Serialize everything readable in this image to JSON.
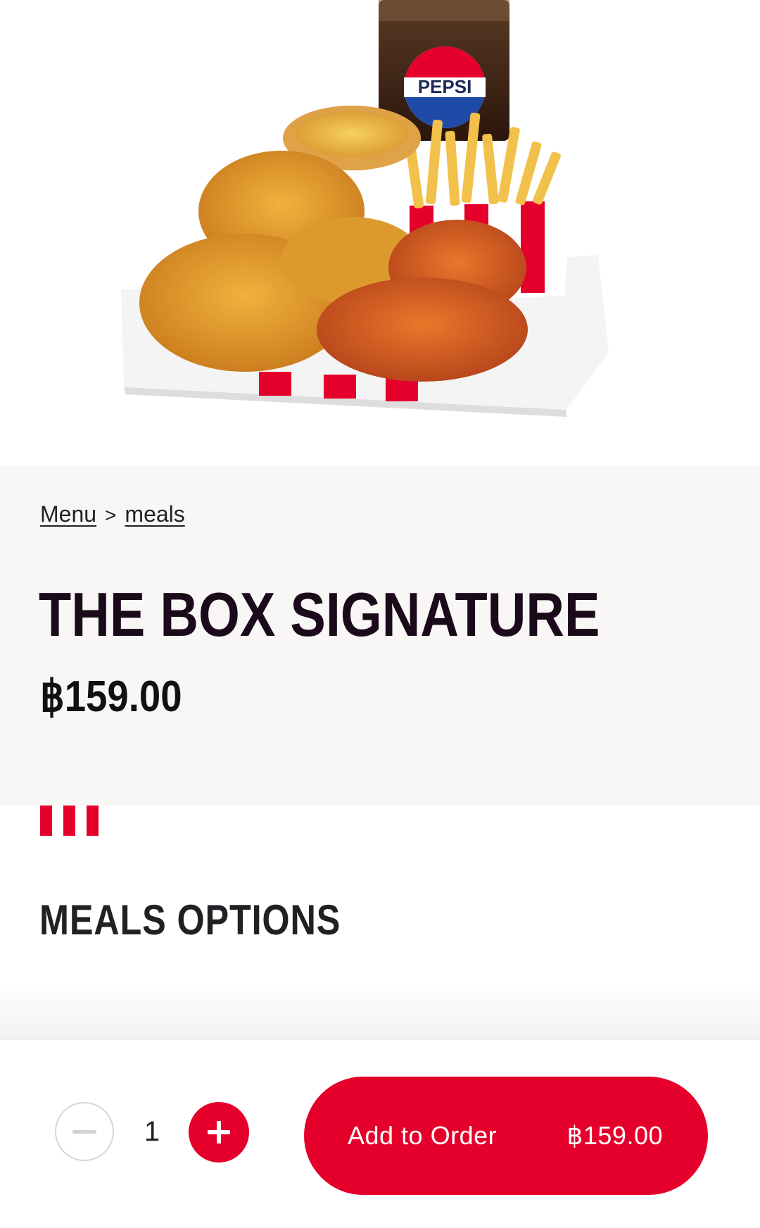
{
  "hero": {
    "image_alt": "The Box Signature meal",
    "drink_logo_text": "PEPSI"
  },
  "breadcrumb": {
    "items": [
      "Menu",
      "meals"
    ],
    "separator": ">"
  },
  "product": {
    "title": "THE BOX SIGNATURE",
    "price": "฿159.00"
  },
  "options": {
    "section_title": "MEALS OPTIONS"
  },
  "order_bar": {
    "quantity": "1",
    "add_label": "Add to Order",
    "total": "฿159.00"
  },
  "colors": {
    "brand_red": "#e4002b",
    "panel_bg": "#f8f7f5",
    "title_color": "#1a0a1a"
  }
}
